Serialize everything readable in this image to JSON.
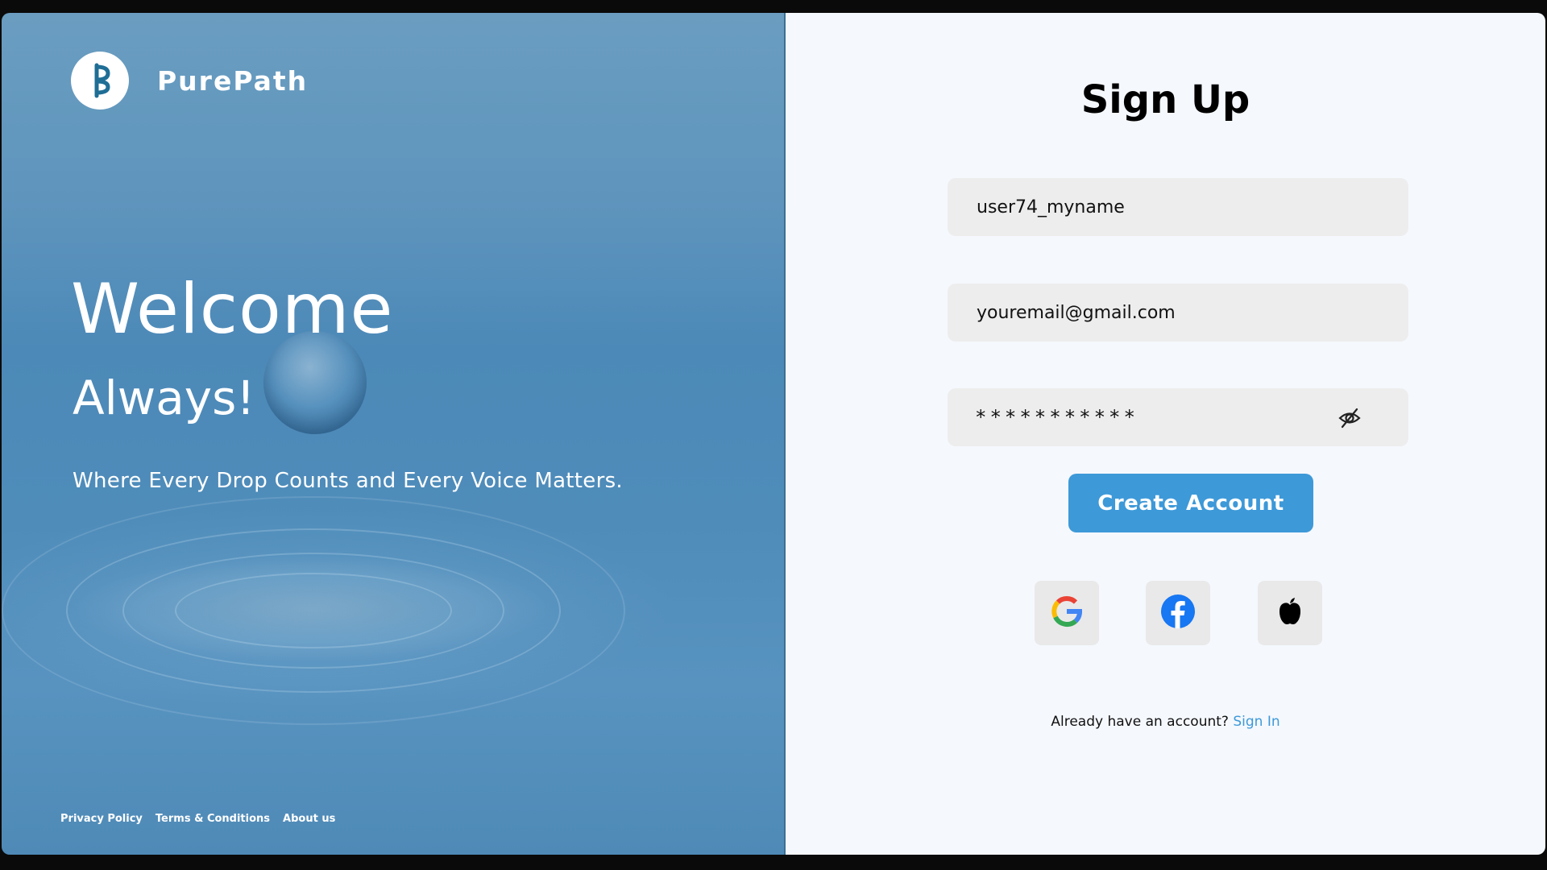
{
  "brand": {
    "name": "PurePath",
    "logo_letter": "P"
  },
  "hero": {
    "heading": "Welcome",
    "subheading": "Always!",
    "tagline": "Where Every Drop Counts and Every Voice Matters."
  },
  "footer": {
    "links": [
      "Privacy Policy",
      "Terms & Conditions",
      "About us"
    ]
  },
  "form": {
    "title": "Sign Up",
    "username_value": "user74_myname",
    "email_value": "youremail@gmail.com",
    "password_mask": "***********",
    "create_label": "Create Account",
    "signin_prompt": "Already have an account?",
    "signin_link": "Sign In"
  },
  "social": [
    "google-icon",
    "facebook-icon",
    "apple-icon"
  ],
  "colors": {
    "accent": "#3d99d8",
    "panel_bg": "#f5f8fd",
    "field_bg": "#ededed",
    "hero_bg": "#5a92bd"
  }
}
